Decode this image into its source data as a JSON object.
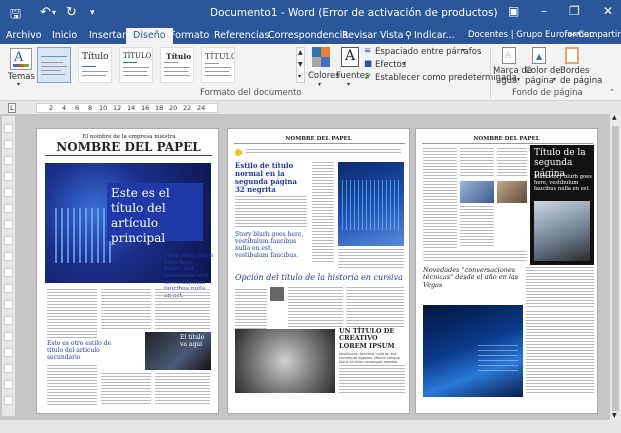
{
  "window": {
    "title": "Documento1 - Word (Error de activación de productos)",
    "save_icon": "save-icon",
    "undo_icon": "undo-icon",
    "redo_icon": "redo-icon"
  },
  "tabs": [
    {
      "label": "Archivo"
    },
    {
      "label": "Inicio"
    },
    {
      "label": "Insertar"
    },
    {
      "label": "Diseño"
    },
    {
      "label": "Formato"
    },
    {
      "label": "Referencias"
    },
    {
      "label": "Correspondencia"
    },
    {
      "label": "Revisar"
    },
    {
      "label": "Vista"
    },
    {
      "label": "Indicar..."
    },
    {
      "label": "Docentes | Grupo Euroformac"
    },
    {
      "label": "Compartir"
    }
  ],
  "ribbon": {
    "temas_label": "Temas",
    "style_thumbs": [
      {
        "title": "Título"
      },
      {
        "title": "TÍTULO"
      },
      {
        "title": "Título"
      },
      {
        "title": "TÍTULO"
      }
    ],
    "colores_label": "Colores",
    "fuentes_label": "Fuentes",
    "espaciado_label": "Espaciado entre párrafos",
    "efectos_label": "Efectos",
    "predeterminada_label": "Establecer como predeterminada",
    "formato_group_label": "Formato del documento",
    "marca_agua_label_1": "Marca de",
    "marca_agua_label_2": "agua",
    "color_pagina_label_1": "Color de",
    "color_pagina_label_2": "página",
    "bordes_label_1": "Bordes",
    "bordes_label_2": "de página",
    "fondo_group_label": "Fondo de página"
  },
  "ruler": {
    "numbers": [
      "2",
      "4",
      "6",
      "8",
      "10",
      "12",
      "14",
      "16",
      "18",
      "20",
      "22",
      "24"
    ]
  },
  "page1": {
    "kicker": "El nombre de la empresa nuestra",
    "masthead": "NOMBRE DEL PAPEL",
    "headline": "Este es el título del artículo principal",
    "blurb": "Main story blurb goes here, donec sed malesuada orci sit vestibulum faucibus nulla an est.",
    "second_headline": "Este es otro estilo de título del artículo secundario",
    "third_headline": "El título va aquí"
  },
  "page2": {
    "masthead": "NOMBRE DEL PAPEL",
    "headline": "Estilo de título normal en la segunda página 32 negrita",
    "blurb": "Story blurb goes here, vestibulum faucibus nulla en est, vestibulum faucibus.",
    "italic_headline": "Opción del título de la historia en cursiva",
    "caps_headline": "UN TÍTULO DE CREATIVO LOREM IPSUM",
    "caps_subtext": "Vestibulum faucibus nulla en est consequat egestas. Mauris congue tellus et dolor consequat egestas."
  },
  "page3": {
    "masthead": "NOMBRE DEL PAPEL",
    "side_title": "Título de la segunda página",
    "side_blurb": "Main story blurb goes here, vestibulum faucibus nulla en est.",
    "script_headline": "Novedades \"conversaciones técnicas\" desde el año en las Vegas"
  }
}
